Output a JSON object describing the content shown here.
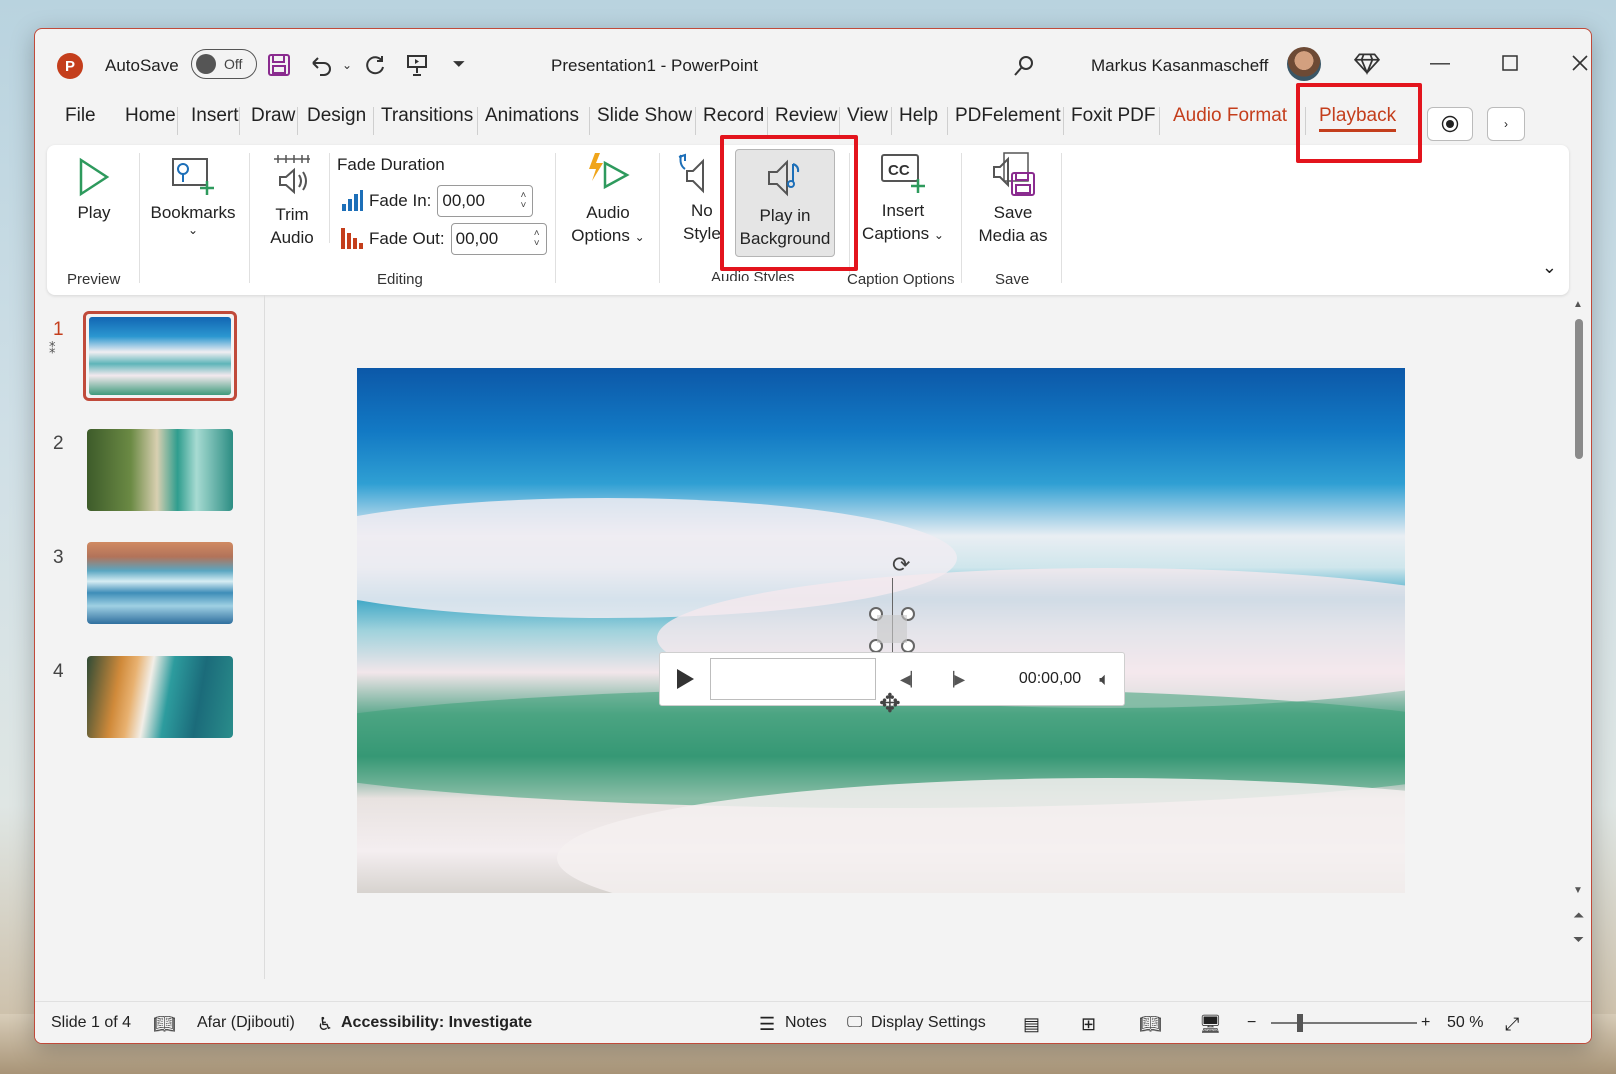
{
  "titlebar": {
    "app_logo": "P",
    "autosave_label": "AutoSave",
    "autosave_state": "Off",
    "document_title": "Presentation1  -  PowerPoint",
    "user_name": "Markus Kasanmascheff"
  },
  "tabs": [
    {
      "label": "File"
    },
    {
      "label": "Home"
    },
    {
      "label": "Insert"
    },
    {
      "label": "Draw"
    },
    {
      "label": "Design"
    },
    {
      "label": "Transitions"
    },
    {
      "label": "Animations"
    },
    {
      "label": "Slide Show"
    },
    {
      "label": "Record"
    },
    {
      "label": "Review"
    },
    {
      "label": "View"
    },
    {
      "label": "Help"
    },
    {
      "label": "PDFelement"
    },
    {
      "label": "Foxit PDF"
    },
    {
      "label": "Audio Format"
    },
    {
      "label": "Playback"
    }
  ],
  "ribbon": {
    "play": "Play",
    "bookmarks": "Bookmarks",
    "preview_group": "Preview",
    "trim_line1": "Trim",
    "trim_line2": "Audio",
    "fade_duration": "Fade Duration",
    "fade_in_label": "Fade In:",
    "fade_in_value": "00,00",
    "fade_out_label": "Fade Out:",
    "fade_out_value": "00,00",
    "editing_group": "Editing",
    "audio_options_line1": "Audio",
    "audio_options_line2": "Options",
    "no_style_line1": "No",
    "no_style_line2": "Style",
    "play_bg_line1": "Play in",
    "play_bg_line2": "Background",
    "audio_styles_group": "Audio Styles",
    "insert_captions_line1": "Insert",
    "insert_captions_line2": "Captions",
    "caption_options_group": "Caption Options",
    "save_media_line1": "Save",
    "save_media_line2": "Media as",
    "save_group": "Save"
  },
  "slides": [
    {
      "number": "1",
      "selected": true
    },
    {
      "number": "2",
      "selected": false
    },
    {
      "number": "3",
      "selected": false
    },
    {
      "number": "4",
      "selected": false
    }
  ],
  "audio_player": {
    "time": "00:00,00"
  },
  "status": {
    "slide_info": "Slide 1 of 4",
    "language": "Afar (Djibouti)",
    "accessibility": "Accessibility: Investigate",
    "notes": "Notes",
    "display_settings": "Display Settings",
    "zoom": "50 %"
  },
  "colors": {
    "accent": "#c43e1c",
    "highlight": "#e3141d"
  }
}
